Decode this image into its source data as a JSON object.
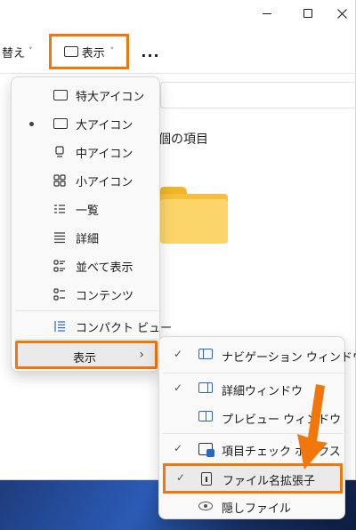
{
  "toolbar": {
    "sort_label": "替え",
    "view_label": "表示",
    "more_label": "..."
  },
  "content": {
    "heading": "個の項目"
  },
  "view_menu": {
    "items": [
      {
        "label": "特大アイコン",
        "icon": "monitor-icon",
        "selected": false
      },
      {
        "label": "大アイコン",
        "icon": "monitor-icon",
        "selected": true
      },
      {
        "label": "中アイコン",
        "icon": "monitor-small-icon",
        "selected": false
      },
      {
        "label": "小アイコン",
        "icon": "grid-icon",
        "selected": false
      },
      {
        "label": "一覧",
        "icon": "list-icon",
        "selected": false
      },
      {
        "label": "詳細",
        "icon": "details-icon",
        "selected": false
      },
      {
        "label": "並べて表示",
        "icon": "tiles-icon",
        "selected": false
      },
      {
        "label": "コンテンツ",
        "icon": "content-icon",
        "selected": false
      },
      {
        "label": "コンパクト ビュー",
        "icon": "compact-icon",
        "selected": false
      }
    ],
    "show_label": "表示"
  },
  "show_submenu": {
    "items": [
      {
        "label": "ナビゲーション ウィンドウ",
        "checked": true,
        "icon": "navigation-pane-icon"
      },
      {
        "label": "詳細ウィンドウ",
        "checked": true,
        "icon": "details-pane-icon"
      },
      {
        "label": "プレビュー ウィンドウ",
        "checked": false,
        "icon": "preview-pane-icon"
      },
      {
        "label": "項目チェック ボックス",
        "checked": true,
        "icon": "item-checkbox-icon"
      },
      {
        "label": "ファイル名拡張子",
        "checked": true,
        "icon": "file-extension-icon"
      },
      {
        "label": "隠しファイル",
        "checked": false,
        "icon": "eye-icon"
      }
    ]
  },
  "colors": {
    "highlight": "#f2770a",
    "accent": "#2767c5",
    "folder": "#f5c03f"
  }
}
